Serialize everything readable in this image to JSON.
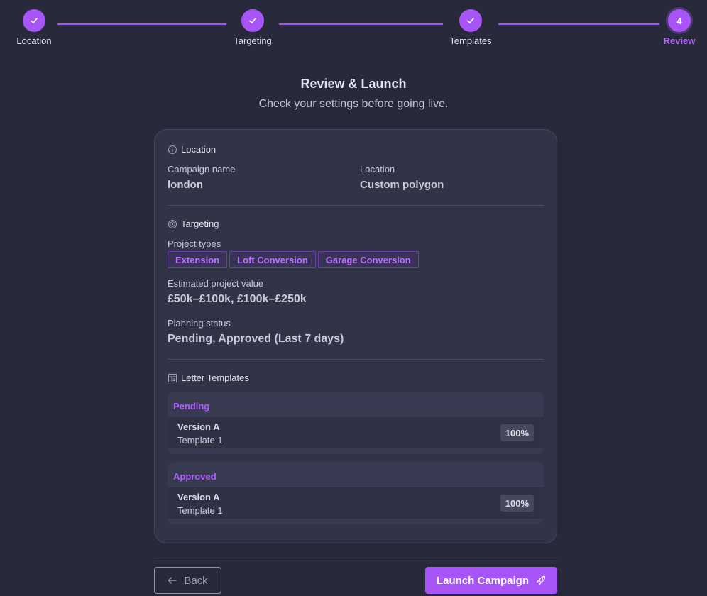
{
  "stepper": {
    "steps": [
      {
        "label": "Location",
        "state": "done"
      },
      {
        "label": "Targeting",
        "state": "done"
      },
      {
        "label": "Templates",
        "state": "done"
      },
      {
        "label": "Review",
        "state": "current",
        "number": "4"
      }
    ],
    "accent": "#a855f7"
  },
  "header": {
    "title": "Review & Launch",
    "subtitle": "Check your settings before going live."
  },
  "location_section": {
    "title": "Location",
    "campaign_name_label": "Campaign name",
    "campaign_name_value": "london",
    "location_label": "Location",
    "location_value": "Custom polygon"
  },
  "targeting_section": {
    "title": "Targeting",
    "project_types_label": "Project types",
    "project_types": [
      "Extension",
      "Loft Conversion",
      "Garage Conversion"
    ],
    "value_label": "Estimated project value",
    "value_value": "£50k–£100k, £100k–£250k",
    "planning_label": "Planning status",
    "planning_value": "Pending, Approved (Last 7 days)"
  },
  "templates_section": {
    "title": "Letter Templates",
    "groups": [
      {
        "name": "Pending",
        "version": "Version A",
        "template": "Template 1",
        "percent": "100%"
      },
      {
        "name": "Approved",
        "version": "Version A",
        "template": "Template 1",
        "percent": "100%"
      }
    ]
  },
  "footer": {
    "back_label": "Back",
    "launch_label": "Launch Campaign"
  }
}
